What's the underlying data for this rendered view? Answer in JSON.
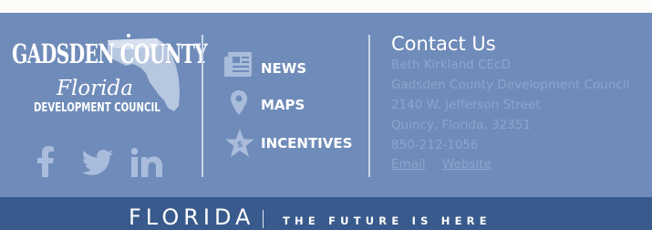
{
  "logo": {
    "title": "GADSDEN COUNTY",
    "script": "Florida",
    "subtitle": "DEVELOPMENT COUNCIL"
  },
  "social": [
    {
      "icon": "facebook-icon"
    },
    {
      "icon": "twitter-icon"
    },
    {
      "icon": "linkedin-icon"
    }
  ],
  "nav": [
    {
      "label": "NEWS",
      "icon": "newspaper-icon"
    },
    {
      "label": "MAPS",
      "icon": "map-pin-icon"
    },
    {
      "label": "INCENTIVES",
      "icon": "star-icon"
    }
  ],
  "contact": {
    "title": "Contact Us",
    "name": "Beth Kirkland CEcD",
    "org": "Gadsden County Development Council",
    "street": "2140 W. Jefferson Street",
    "city": "Quincy, Florida, 32351",
    "phone": "850-212-1056",
    "email_label": "Email",
    "website_label": "Website"
  },
  "brand": {
    "word": "FLORIDA",
    "tagline": "THE FUTURE IS HERE"
  },
  "colors": {
    "footer_bg": "#6f8bb9",
    "bottom_bar": "#395a8c",
    "muted_text": "#8ca5cc",
    "icon_tint": "#a9bcdc"
  }
}
